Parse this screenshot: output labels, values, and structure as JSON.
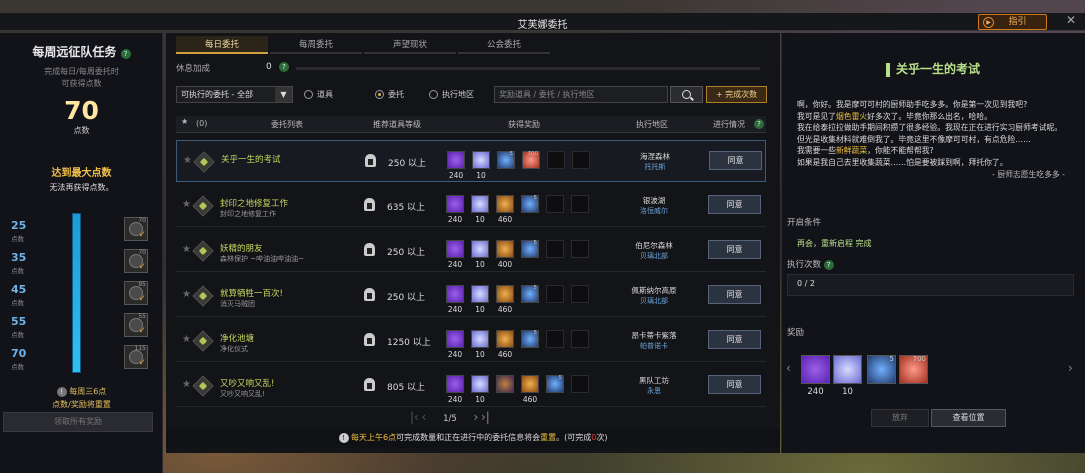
{
  "window_title": "艾芙娜委托",
  "guide_label": "指引",
  "left": {
    "title": "每周远征队任务",
    "desc_line1": "完成每日/每周委托时",
    "desc_line2": "可获得点数",
    "points_value": "70",
    "points_unit": "点数",
    "max_reached": "达到最大点数",
    "no_more": "无法再获得点数。",
    "progress": 1.0,
    "tiers": [
      {
        "value": "25",
        "unit": "点数",
        "reward_count": "70"
      },
      {
        "value": "35",
        "unit": "点数",
        "reward_count": "70"
      },
      {
        "value": "45",
        "unit": "点数",
        "reward_count": "95"
      },
      {
        "value": "55",
        "unit": "点数",
        "reward_count": "55"
      },
      {
        "value": "70",
        "unit": "点数",
        "reward_count": "115"
      }
    ],
    "reset_note1": "每周三6点",
    "reset_note2": "点数/奖励将重置",
    "claim_all": "领取所有奖励"
  },
  "tabs": [
    "每日委托",
    "每周委托",
    "声望现状",
    "公会委托"
  ],
  "rest_bonus_label": "休息加成",
  "rest_bonus_value": "0",
  "filter": {
    "select_value": "可执行的委托 - 全部",
    "radio_items": [
      "道具",
      "委托",
      "执行地区"
    ],
    "radio_selected": 1,
    "search_placeholder": "奖励道具 / 委托 / 执行地区",
    "complete_button": "+ 完成次数"
  },
  "table": {
    "star_count": "(0)",
    "headers": [
      "委托列表",
      "推荐道具等级",
      "获得奖励",
      "执行地区",
      "进行情况"
    ],
    "agree_label": "同意",
    "rows": [
      {
        "name": "关乎一生的考试",
        "sub": "",
        "level": "250 以上",
        "region": "海涅森林",
        "area": "托托斯",
        "rewards": [
          {
            "t": "purple",
            "n": "240"
          },
          {
            "t": "gem",
            "n": "10"
          },
          {
            "t": "blue",
            "n": "",
            "c": "5"
          },
          {
            "t": "heart",
            "n": "",
            "c": "700"
          },
          {
            "t": "empty",
            "n": ""
          },
          {
            "t": "empty",
            "n": ""
          }
        ]
      },
      {
        "name": "封印之地修复工作",
        "sub": "封印之地修复工作",
        "level": "635 以上",
        "region": "银波湖",
        "area": "洛恒威尔",
        "rewards": [
          {
            "t": "purple",
            "n": "240"
          },
          {
            "t": "gem",
            "n": "10"
          },
          {
            "t": "flask",
            "n": "460"
          },
          {
            "t": "blue",
            "n": "",
            "c": "5"
          },
          {
            "t": "empty",
            "n": ""
          },
          {
            "t": "empty",
            "n": ""
          }
        ]
      },
      {
        "name": "妖精的朋友",
        "sub": "森林保护 ~哔油油哔油油~",
        "level": "250 以上",
        "region": "伯尼尔森林",
        "area": "贝璃北部",
        "rewards": [
          {
            "t": "purple",
            "n": "240"
          },
          {
            "t": "gem",
            "n": "10"
          },
          {
            "t": "flask",
            "n": "400"
          },
          {
            "t": "blue",
            "n": "",
            "c": "5"
          },
          {
            "t": "empty",
            "n": ""
          },
          {
            "t": "empty",
            "n": ""
          }
        ]
      },
      {
        "name": "就算牺牲一百次!",
        "sub": "消灭马贼团",
        "level": "250 以上",
        "region": "佩斯纳尔高原",
        "area": "贝璃北部",
        "rewards": [
          {
            "t": "purple",
            "n": "240"
          },
          {
            "t": "gem",
            "n": "10"
          },
          {
            "t": "flask",
            "n": "460"
          },
          {
            "t": "blue",
            "n": "",
            "c": "5"
          },
          {
            "t": "empty",
            "n": ""
          },
          {
            "t": "empty",
            "n": ""
          }
        ]
      },
      {
        "name": "净化池塘",
        "sub": "净化仪式",
        "level": "1250 以上",
        "region": "昂卡蒂卡紫落",
        "area": "帕普诺卡",
        "rewards": [
          {
            "t": "purple",
            "n": "240"
          },
          {
            "t": "gem",
            "n": "10"
          },
          {
            "t": "flask",
            "n": "460"
          },
          {
            "t": "blue",
            "n": "",
            "c": "5"
          },
          {
            "t": "empty",
            "n": ""
          },
          {
            "t": "empty",
            "n": ""
          }
        ]
      },
      {
        "name": "又吵又响又乱!",
        "sub": "又吵又响又乱!",
        "level": "805 以上",
        "region": "黑队工坊",
        "area": "永恩",
        "rewards": [
          {
            "t": "purple",
            "n": "240"
          },
          {
            "t": "gem",
            "n": "10"
          },
          {
            "t": "mixed",
            "n": ""
          },
          {
            "t": "flask",
            "n": "460"
          },
          {
            "t": "blue",
            "n": "",
            "c": "5"
          },
          {
            "t": "empty",
            "n": ""
          }
        ]
      }
    ]
  },
  "pager": "1/5",
  "notice": {
    "pre": "每天上午6点",
    "mid": "可完成数量和正在进行中的委托信息将会",
    "reset": "重置",
    "post_a": "。(可完成",
    "count": "0",
    "post_b": "次)"
  },
  "right": {
    "title": "关乎一生的考试",
    "story": [
      "啊，你好。我是摩可可村的厨师助手吃多多。你是第一次见到我吧?",
      "我可是见了烟色雷火好多次了。毕竟你那么出名，哈哈。",
      "我在给泰拉拉做助手期间积攒了很多经验。我现在正在进行实习厨师考试呢。",
      "但光是收集材料就难倒我了。毕竟这里不像摩可可村，有点危险……",
      "我需要一些新鲜蔬菜，你能不能帮帮我?",
      "如果是我自己去里收集蔬菜……怕是要被踩到啊，拜托你了。"
    ],
    "signature": "- 厨师志愿生吃多多 -",
    "open_condition_label": "开启条件",
    "open_condition_value": "再会，重新启程 完成",
    "exec_count_label": "执行次数",
    "exec_count_value": "0 / 2",
    "reward_label": "奖励",
    "rewards": [
      {
        "t": "purple",
        "n": "240"
      },
      {
        "t": "gem",
        "n": "10"
      },
      {
        "t": "blue",
        "n": "",
        "c": "5"
      },
      {
        "t": "heart",
        "n": "",
        "c": "700"
      }
    ],
    "abandon": "放弃",
    "view_position": "查看位置"
  }
}
